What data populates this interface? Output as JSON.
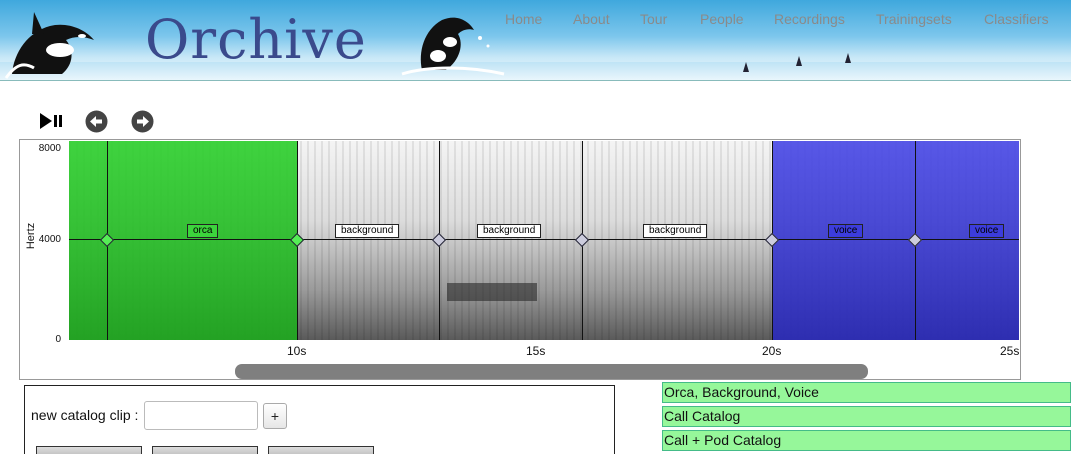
{
  "header": {
    "logo_text": "Orchive",
    "nav": [
      {
        "label": "Home"
      },
      {
        "label": "About"
      },
      {
        "label": "Tour"
      },
      {
        "label": "People"
      },
      {
        "label": "Recordings"
      },
      {
        "label": "Trainingsets"
      },
      {
        "label": "Classifiers"
      }
    ]
  },
  "controls": {
    "play_pause_icon": "play-pause-icon",
    "back_icon": "arrow-left-circle-icon",
    "forward_icon": "arrow-right-circle-icon"
  },
  "spectrogram": {
    "y_axis_label": "Hertz",
    "y_ticks": [
      "8000",
      "4000",
      "0"
    ],
    "x_ticks": [
      "10s",
      "15s",
      "20s",
      "25s"
    ],
    "segments": [
      {
        "label": "orca",
        "color": "#3cd43c"
      },
      {
        "label": "background",
        "color": "#ffffff"
      },
      {
        "label": "background",
        "color": "#ffffff"
      },
      {
        "label": "background",
        "color": "#ffffff"
      },
      {
        "label": "voice",
        "color": "#3c3cdc"
      },
      {
        "label": "voice",
        "color": "#3c3cdc"
      }
    ]
  },
  "clip_panel": {
    "label": "new catalog clip :",
    "input_value": "",
    "add_label": "+"
  },
  "catalogs": [
    {
      "label": "Orca, Background, Voice"
    },
    {
      "label": "Call Catalog"
    },
    {
      "label": "Call + Pod Catalog"
    }
  ]
}
